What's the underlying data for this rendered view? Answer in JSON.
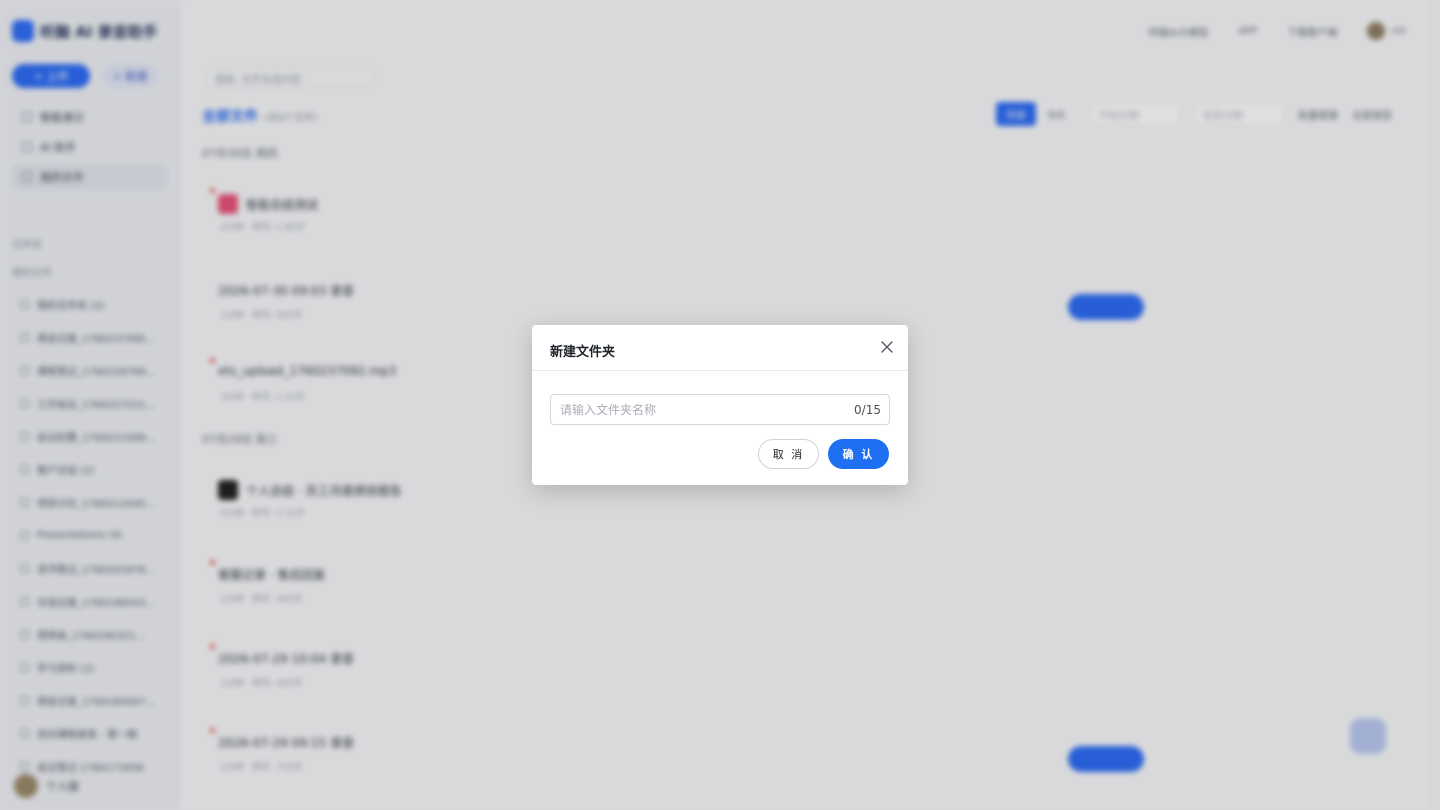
{
  "background": {
    "brand": "听脑 AI 录音助手",
    "new_button": "+ 上传",
    "import_button": "+ 新建",
    "nav": [
      "智能速记",
      "AI 助手",
      "我的文件"
    ],
    "section_files": "文件夹",
    "section_recent": "我的文件",
    "sidebar_files": [
      "我的文件夹 (3)",
      "周会记录_1760237495...",
      "课程笔记_1760228789...",
      "工作会议_1760227221...",
      "会议纪要_1760221099...",
      "客户访谈 (2)",
      "项目讨论_1760212045...",
      "Presentations (4)",
      "读书笔记_1760201876...",
      "访谈记录_1760196543...",
      "周例会_1760190321...",
      "学习资料 (2)",
      "周会记录_1760184567...",
      "培训课程录音 - 第一期",
      "会议笔记 1760173456"
    ],
    "user_name": "个人版",
    "topbar": [
      "听脑AI大模型",
      "APP",
      "下载客户端",
      "chi"
    ],
    "search_placeholder": "搜索, 文件名或内容",
    "header_title": "全部文件",
    "header_sub": "(共8个文件)",
    "toolbar": [
      "列表",
      "卡片",
      "开始日期",
      "结束日期",
      "批量管理",
      "全部类型"
    ],
    "group_today": "07月30日 周四",
    "group_earlier": "07月29日 周三",
    "rows": [
      {
        "title": "智能总结测试",
        "meta": "2分钟  ·  转写: 1.8k字"
      },
      {
        "title": "2026-07-30 09:03 录音",
        "meta": "1分钟  ·  转写: 600字"
      },
      {
        "title": "ets_upload_1760237092.mp3",
        "meta": "3分钟  ·  转写: 1.2k字"
      },
      {
        "title": "个人总结 · 员工月度绩效报告",
        "meta": "5分钟  ·  转写: 3.1k字"
      },
      {
        "title": "客服记录 · 售后回复",
        "meta": "2分钟  ·  转写: 900字"
      },
      {
        "title": "2026-07-29 10:04 录音",
        "meta": "1分钟  ·  转写: 400字"
      },
      {
        "title": "2026-07-29 09:15 录音",
        "meta": "2分钟  ·  转写: 700字"
      }
    ]
  },
  "modal": {
    "title": "新建文件夹",
    "input_placeholder": "请输入文件夹名称",
    "input_value": "",
    "counter": "0/15",
    "cancel_label": "取 消",
    "confirm_label": "确 认"
  },
  "colors": {
    "primary": "#1e6ff1",
    "overlay": "rgba(0,0,0,0.12)"
  }
}
